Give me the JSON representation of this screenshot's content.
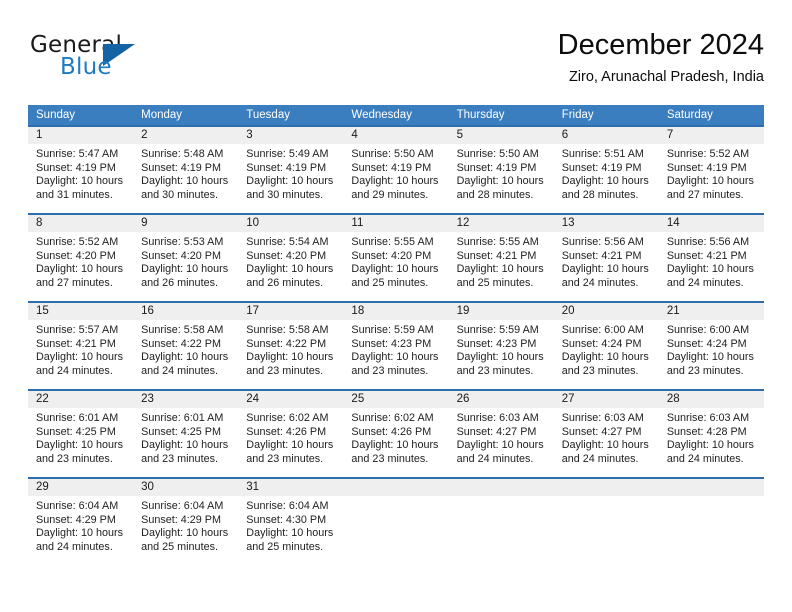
{
  "brand": {
    "word1": "General",
    "word2": "Blue",
    "triangle_color": "#1464a5",
    "blue_color": "#1f7ac4"
  },
  "header": {
    "title": "December 2024",
    "subtitle": "Ziro, Arunachal Pradesh, India"
  },
  "theme": {
    "header_blue": "#3b7ebf",
    "row_divider_blue": "#2d6fae",
    "day_strip_gray": "#efefef"
  },
  "weekdays": [
    "Sunday",
    "Monday",
    "Tuesday",
    "Wednesday",
    "Thursday",
    "Friday",
    "Saturday"
  ],
  "weeks": [
    [
      {
        "day": "1",
        "sunrise": "Sunrise: 5:47 AM",
        "sunset": "Sunset: 4:19 PM",
        "daylight1": "Daylight: 10 hours",
        "daylight2": "and 31 minutes."
      },
      {
        "day": "2",
        "sunrise": "Sunrise: 5:48 AM",
        "sunset": "Sunset: 4:19 PM",
        "daylight1": "Daylight: 10 hours",
        "daylight2": "and 30 minutes."
      },
      {
        "day": "3",
        "sunrise": "Sunrise: 5:49 AM",
        "sunset": "Sunset: 4:19 PM",
        "daylight1": "Daylight: 10 hours",
        "daylight2": "and 30 minutes."
      },
      {
        "day": "4",
        "sunrise": "Sunrise: 5:50 AM",
        "sunset": "Sunset: 4:19 PM",
        "daylight1": "Daylight: 10 hours",
        "daylight2": "and 29 minutes."
      },
      {
        "day": "5",
        "sunrise": "Sunrise: 5:50 AM",
        "sunset": "Sunset: 4:19 PM",
        "daylight1": "Daylight: 10 hours",
        "daylight2": "and 28 minutes."
      },
      {
        "day": "6",
        "sunrise": "Sunrise: 5:51 AM",
        "sunset": "Sunset: 4:19 PM",
        "daylight1": "Daylight: 10 hours",
        "daylight2": "and 28 minutes."
      },
      {
        "day": "7",
        "sunrise": "Sunrise: 5:52 AM",
        "sunset": "Sunset: 4:19 PM",
        "daylight1": "Daylight: 10 hours",
        "daylight2": "and 27 minutes."
      }
    ],
    [
      {
        "day": "8",
        "sunrise": "Sunrise: 5:52 AM",
        "sunset": "Sunset: 4:20 PM",
        "daylight1": "Daylight: 10 hours",
        "daylight2": "and 27 minutes."
      },
      {
        "day": "9",
        "sunrise": "Sunrise: 5:53 AM",
        "sunset": "Sunset: 4:20 PM",
        "daylight1": "Daylight: 10 hours",
        "daylight2": "and 26 minutes."
      },
      {
        "day": "10",
        "sunrise": "Sunrise: 5:54 AM",
        "sunset": "Sunset: 4:20 PM",
        "daylight1": "Daylight: 10 hours",
        "daylight2": "and 26 minutes."
      },
      {
        "day": "11",
        "sunrise": "Sunrise: 5:55 AM",
        "sunset": "Sunset: 4:20 PM",
        "daylight1": "Daylight: 10 hours",
        "daylight2": "and 25 minutes."
      },
      {
        "day": "12",
        "sunrise": "Sunrise: 5:55 AM",
        "sunset": "Sunset: 4:21 PM",
        "daylight1": "Daylight: 10 hours",
        "daylight2": "and 25 minutes."
      },
      {
        "day": "13",
        "sunrise": "Sunrise: 5:56 AM",
        "sunset": "Sunset: 4:21 PM",
        "daylight1": "Daylight: 10 hours",
        "daylight2": "and 24 minutes."
      },
      {
        "day": "14",
        "sunrise": "Sunrise: 5:56 AM",
        "sunset": "Sunset: 4:21 PM",
        "daylight1": "Daylight: 10 hours",
        "daylight2": "and 24 minutes."
      }
    ],
    [
      {
        "day": "15",
        "sunrise": "Sunrise: 5:57 AM",
        "sunset": "Sunset: 4:21 PM",
        "daylight1": "Daylight: 10 hours",
        "daylight2": "and 24 minutes."
      },
      {
        "day": "16",
        "sunrise": "Sunrise: 5:58 AM",
        "sunset": "Sunset: 4:22 PM",
        "daylight1": "Daylight: 10 hours",
        "daylight2": "and 24 minutes."
      },
      {
        "day": "17",
        "sunrise": "Sunrise: 5:58 AM",
        "sunset": "Sunset: 4:22 PM",
        "daylight1": "Daylight: 10 hours",
        "daylight2": "and 23 minutes."
      },
      {
        "day": "18",
        "sunrise": "Sunrise: 5:59 AM",
        "sunset": "Sunset: 4:23 PM",
        "daylight1": "Daylight: 10 hours",
        "daylight2": "and 23 minutes."
      },
      {
        "day": "19",
        "sunrise": "Sunrise: 5:59 AM",
        "sunset": "Sunset: 4:23 PM",
        "daylight1": "Daylight: 10 hours",
        "daylight2": "and 23 minutes."
      },
      {
        "day": "20",
        "sunrise": "Sunrise: 6:00 AM",
        "sunset": "Sunset: 4:24 PM",
        "daylight1": "Daylight: 10 hours",
        "daylight2": "and 23 minutes."
      },
      {
        "day": "21",
        "sunrise": "Sunrise: 6:00 AM",
        "sunset": "Sunset: 4:24 PM",
        "daylight1": "Daylight: 10 hours",
        "daylight2": "and 23 minutes."
      }
    ],
    [
      {
        "day": "22",
        "sunrise": "Sunrise: 6:01 AM",
        "sunset": "Sunset: 4:25 PM",
        "daylight1": "Daylight: 10 hours",
        "daylight2": "and 23 minutes."
      },
      {
        "day": "23",
        "sunrise": "Sunrise: 6:01 AM",
        "sunset": "Sunset: 4:25 PM",
        "daylight1": "Daylight: 10 hours",
        "daylight2": "and 23 minutes."
      },
      {
        "day": "24",
        "sunrise": "Sunrise: 6:02 AM",
        "sunset": "Sunset: 4:26 PM",
        "daylight1": "Daylight: 10 hours",
        "daylight2": "and 23 minutes."
      },
      {
        "day": "25",
        "sunrise": "Sunrise: 6:02 AM",
        "sunset": "Sunset: 4:26 PM",
        "daylight1": "Daylight: 10 hours",
        "daylight2": "and 23 minutes."
      },
      {
        "day": "26",
        "sunrise": "Sunrise: 6:03 AM",
        "sunset": "Sunset: 4:27 PM",
        "daylight1": "Daylight: 10 hours",
        "daylight2": "and 24 minutes."
      },
      {
        "day": "27",
        "sunrise": "Sunrise: 6:03 AM",
        "sunset": "Sunset: 4:27 PM",
        "daylight1": "Daylight: 10 hours",
        "daylight2": "and 24 minutes."
      },
      {
        "day": "28",
        "sunrise": "Sunrise: 6:03 AM",
        "sunset": "Sunset: 4:28 PM",
        "daylight1": "Daylight: 10 hours",
        "daylight2": "and 24 minutes."
      }
    ],
    [
      {
        "day": "29",
        "sunrise": "Sunrise: 6:04 AM",
        "sunset": "Sunset: 4:29 PM",
        "daylight1": "Daylight: 10 hours",
        "daylight2": "and 24 minutes."
      },
      {
        "day": "30",
        "sunrise": "Sunrise: 6:04 AM",
        "sunset": "Sunset: 4:29 PM",
        "daylight1": "Daylight: 10 hours",
        "daylight2": "and 25 minutes."
      },
      {
        "day": "31",
        "sunrise": "Sunrise: 6:04 AM",
        "sunset": "Sunset: 4:30 PM",
        "daylight1": "Daylight: 10 hours",
        "daylight2": "and 25 minutes."
      },
      {
        "day": "",
        "sunrise": "",
        "sunset": "",
        "daylight1": "",
        "daylight2": ""
      },
      {
        "day": "",
        "sunrise": "",
        "sunset": "",
        "daylight1": "",
        "daylight2": ""
      },
      {
        "day": "",
        "sunrise": "",
        "sunset": "",
        "daylight1": "",
        "daylight2": ""
      },
      {
        "day": "",
        "sunrise": "",
        "sunset": "",
        "daylight1": "",
        "daylight2": ""
      }
    ]
  ]
}
